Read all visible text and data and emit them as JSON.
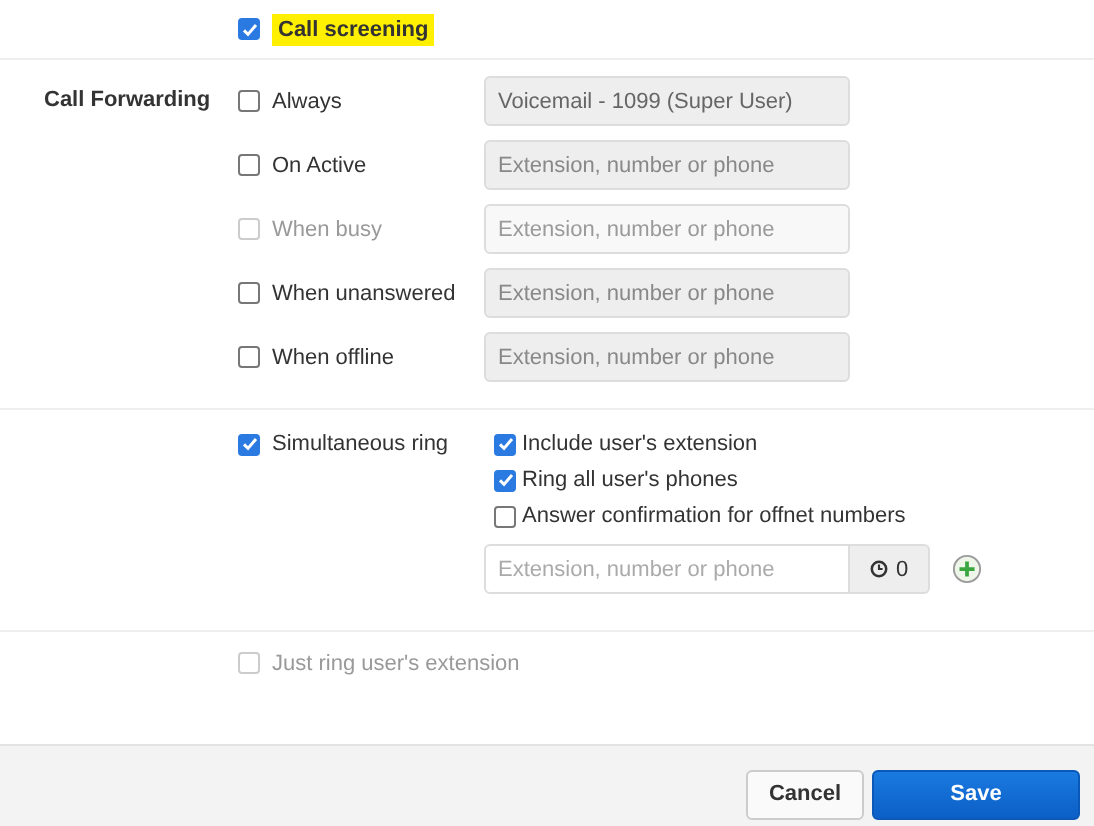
{
  "call_screening": {
    "label": "Call screening",
    "checked": true
  },
  "call_forwarding": {
    "title": "Call Forwarding",
    "rules": [
      {
        "label": "Always",
        "checked": false,
        "disabled": false,
        "value": "Voicemail - 1099 (Super User)"
      },
      {
        "label": "On Active",
        "checked": false,
        "disabled": false,
        "placeholder": "Extension, number or phone"
      },
      {
        "label": "When busy",
        "checked": false,
        "disabled": true,
        "placeholder": "Extension, number or phone"
      },
      {
        "label": "When unanswered",
        "checked": false,
        "disabled": false,
        "placeholder": "Extension, number or phone"
      },
      {
        "label": "When offline",
        "checked": false,
        "disabled": false,
        "placeholder": "Extension, number or phone"
      }
    ]
  },
  "simultaneous_ring": {
    "label": "Simultaneous ring",
    "checked": true,
    "options": [
      {
        "label": "Include user's extension",
        "checked": true
      },
      {
        "label": "Ring all user's phones",
        "checked": true
      },
      {
        "label": "Answer confirmation for offnet numbers",
        "checked": false
      }
    ],
    "placeholder": "Extension, number or phone",
    "timer": "0"
  },
  "just_ring": {
    "label": "Just ring user's extension",
    "checked": false,
    "disabled": true
  },
  "buttons": [
    {
      "label": "Cancel",
      "kind": "secondary"
    },
    {
      "label": "Save",
      "kind": "primary"
    }
  ]
}
